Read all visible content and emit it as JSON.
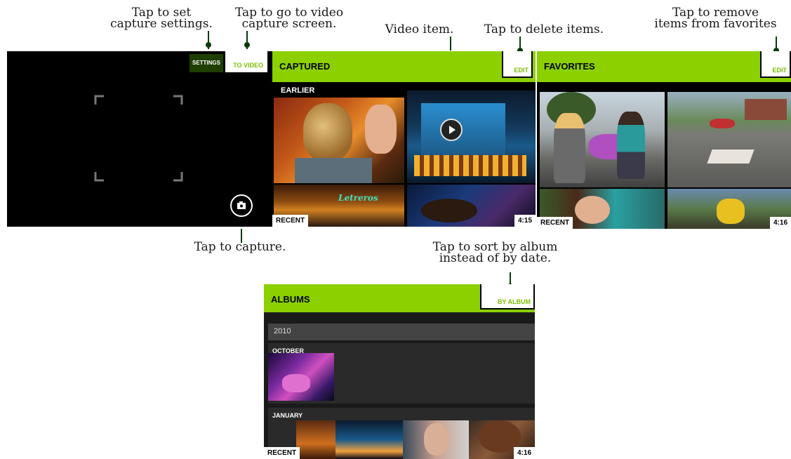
{
  "callouts": {
    "capture_settings": [
      "Tap to set",
      "capture settings."
    ],
    "video_capture": [
      "Tap to go to video",
      "capture screen."
    ],
    "video_item": [
      "Video item."
    ],
    "delete_items": [
      "Tap to delete items."
    ],
    "remove_favorites": [
      "Tap to remove",
      "items from favorites"
    ],
    "capture": [
      "Tap to capture."
    ],
    "sort_album": [
      "Tap to sort by album",
      "instead of by date."
    ]
  },
  "camera": {
    "settings_label": "SETTINGS",
    "to_video_label": "TO VIDEO",
    "capture_icon": "camera-capture-icon"
  },
  "captured": {
    "title": "CAPTURED",
    "edit_label": "EDIT",
    "section": "EARLIER",
    "recent_label": "RECENT",
    "time": "4:15",
    "neon_sign": "Letreros",
    "play_icon": "play-icon"
  },
  "favorites": {
    "title": "FAVORITES",
    "edit_label": "EDIT",
    "recent_label": "RECENT",
    "time": "4:16"
  },
  "albums": {
    "title": "ALBUMS",
    "by_album_label": "BY ALBUM",
    "year": "2010",
    "month1": "OCTOBER",
    "month2": "JANUARY",
    "recent_label": "RECENT",
    "time": "4:16"
  },
  "colors": {
    "accent_green": "#8cd000",
    "leader_dark_green": "#0c3a0c",
    "background_black": "#000000"
  }
}
